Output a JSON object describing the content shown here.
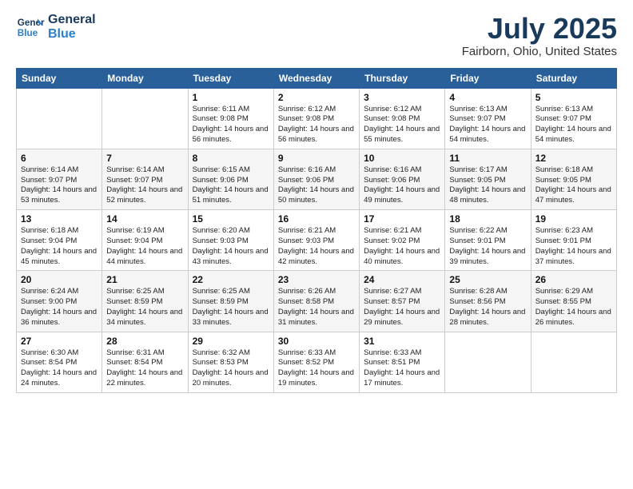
{
  "header": {
    "logo_line1": "General",
    "logo_line2": "Blue",
    "month": "July 2025",
    "location": "Fairborn, Ohio, United States"
  },
  "weekdays": [
    "Sunday",
    "Monday",
    "Tuesday",
    "Wednesday",
    "Thursday",
    "Friday",
    "Saturday"
  ],
  "weeks": [
    [
      {
        "day": "",
        "sunrise": "",
        "sunset": "",
        "daylight": ""
      },
      {
        "day": "",
        "sunrise": "",
        "sunset": "",
        "daylight": ""
      },
      {
        "day": "1",
        "sunrise": "Sunrise: 6:11 AM",
        "sunset": "Sunset: 9:08 PM",
        "daylight": "Daylight: 14 hours and 56 minutes."
      },
      {
        "day": "2",
        "sunrise": "Sunrise: 6:12 AM",
        "sunset": "Sunset: 9:08 PM",
        "daylight": "Daylight: 14 hours and 56 minutes."
      },
      {
        "day": "3",
        "sunrise": "Sunrise: 6:12 AM",
        "sunset": "Sunset: 9:08 PM",
        "daylight": "Daylight: 14 hours and 55 minutes."
      },
      {
        "day": "4",
        "sunrise": "Sunrise: 6:13 AM",
        "sunset": "Sunset: 9:07 PM",
        "daylight": "Daylight: 14 hours and 54 minutes."
      },
      {
        "day": "5",
        "sunrise": "Sunrise: 6:13 AM",
        "sunset": "Sunset: 9:07 PM",
        "daylight": "Daylight: 14 hours and 54 minutes."
      }
    ],
    [
      {
        "day": "6",
        "sunrise": "Sunrise: 6:14 AM",
        "sunset": "Sunset: 9:07 PM",
        "daylight": "Daylight: 14 hours and 53 minutes."
      },
      {
        "day": "7",
        "sunrise": "Sunrise: 6:14 AM",
        "sunset": "Sunset: 9:07 PM",
        "daylight": "Daylight: 14 hours and 52 minutes."
      },
      {
        "day": "8",
        "sunrise": "Sunrise: 6:15 AM",
        "sunset": "Sunset: 9:06 PM",
        "daylight": "Daylight: 14 hours and 51 minutes."
      },
      {
        "day": "9",
        "sunrise": "Sunrise: 6:16 AM",
        "sunset": "Sunset: 9:06 PM",
        "daylight": "Daylight: 14 hours and 50 minutes."
      },
      {
        "day": "10",
        "sunrise": "Sunrise: 6:16 AM",
        "sunset": "Sunset: 9:06 PM",
        "daylight": "Daylight: 14 hours and 49 minutes."
      },
      {
        "day": "11",
        "sunrise": "Sunrise: 6:17 AM",
        "sunset": "Sunset: 9:05 PM",
        "daylight": "Daylight: 14 hours and 48 minutes."
      },
      {
        "day": "12",
        "sunrise": "Sunrise: 6:18 AM",
        "sunset": "Sunset: 9:05 PM",
        "daylight": "Daylight: 14 hours and 47 minutes."
      }
    ],
    [
      {
        "day": "13",
        "sunrise": "Sunrise: 6:18 AM",
        "sunset": "Sunset: 9:04 PM",
        "daylight": "Daylight: 14 hours and 45 minutes."
      },
      {
        "day": "14",
        "sunrise": "Sunrise: 6:19 AM",
        "sunset": "Sunset: 9:04 PM",
        "daylight": "Daylight: 14 hours and 44 minutes."
      },
      {
        "day": "15",
        "sunrise": "Sunrise: 6:20 AM",
        "sunset": "Sunset: 9:03 PM",
        "daylight": "Daylight: 14 hours and 43 minutes."
      },
      {
        "day": "16",
        "sunrise": "Sunrise: 6:21 AM",
        "sunset": "Sunset: 9:03 PM",
        "daylight": "Daylight: 14 hours and 42 minutes."
      },
      {
        "day": "17",
        "sunrise": "Sunrise: 6:21 AM",
        "sunset": "Sunset: 9:02 PM",
        "daylight": "Daylight: 14 hours and 40 minutes."
      },
      {
        "day": "18",
        "sunrise": "Sunrise: 6:22 AM",
        "sunset": "Sunset: 9:01 PM",
        "daylight": "Daylight: 14 hours and 39 minutes."
      },
      {
        "day": "19",
        "sunrise": "Sunrise: 6:23 AM",
        "sunset": "Sunset: 9:01 PM",
        "daylight": "Daylight: 14 hours and 37 minutes."
      }
    ],
    [
      {
        "day": "20",
        "sunrise": "Sunrise: 6:24 AM",
        "sunset": "Sunset: 9:00 PM",
        "daylight": "Daylight: 14 hours and 36 minutes."
      },
      {
        "day": "21",
        "sunrise": "Sunrise: 6:25 AM",
        "sunset": "Sunset: 8:59 PM",
        "daylight": "Daylight: 14 hours and 34 minutes."
      },
      {
        "day": "22",
        "sunrise": "Sunrise: 6:25 AM",
        "sunset": "Sunset: 8:59 PM",
        "daylight": "Daylight: 14 hours and 33 minutes."
      },
      {
        "day": "23",
        "sunrise": "Sunrise: 6:26 AM",
        "sunset": "Sunset: 8:58 PM",
        "daylight": "Daylight: 14 hours and 31 minutes."
      },
      {
        "day": "24",
        "sunrise": "Sunrise: 6:27 AM",
        "sunset": "Sunset: 8:57 PM",
        "daylight": "Daylight: 14 hours and 29 minutes."
      },
      {
        "day": "25",
        "sunrise": "Sunrise: 6:28 AM",
        "sunset": "Sunset: 8:56 PM",
        "daylight": "Daylight: 14 hours and 28 minutes."
      },
      {
        "day": "26",
        "sunrise": "Sunrise: 6:29 AM",
        "sunset": "Sunset: 8:55 PM",
        "daylight": "Daylight: 14 hours and 26 minutes."
      }
    ],
    [
      {
        "day": "27",
        "sunrise": "Sunrise: 6:30 AM",
        "sunset": "Sunset: 8:54 PM",
        "daylight": "Daylight: 14 hours and 24 minutes."
      },
      {
        "day": "28",
        "sunrise": "Sunrise: 6:31 AM",
        "sunset": "Sunset: 8:54 PM",
        "daylight": "Daylight: 14 hours and 22 minutes."
      },
      {
        "day": "29",
        "sunrise": "Sunrise: 6:32 AM",
        "sunset": "Sunset: 8:53 PM",
        "daylight": "Daylight: 14 hours and 20 minutes."
      },
      {
        "day": "30",
        "sunrise": "Sunrise: 6:33 AM",
        "sunset": "Sunset: 8:52 PM",
        "daylight": "Daylight: 14 hours and 19 minutes."
      },
      {
        "day": "31",
        "sunrise": "Sunrise: 6:33 AM",
        "sunset": "Sunset: 8:51 PM",
        "daylight": "Daylight: 14 hours and 17 minutes."
      },
      {
        "day": "",
        "sunrise": "",
        "sunset": "",
        "daylight": ""
      },
      {
        "day": "",
        "sunrise": "",
        "sunset": "",
        "daylight": ""
      }
    ]
  ]
}
